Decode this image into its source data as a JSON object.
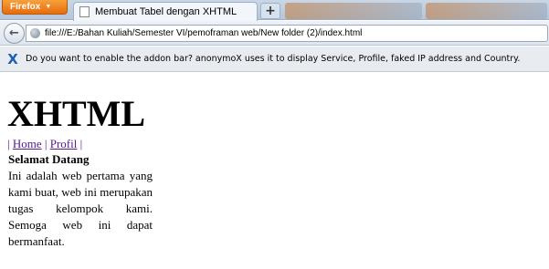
{
  "browser": {
    "menu_button": "Firefox",
    "tab_title": "Membuat Tabel dengan XHTML",
    "new_tab_symbol": "+",
    "url": "file:///E:/Bahan Kuliah/Semester VI/pemoframan web/New folder (2)/index.html"
  },
  "notification": {
    "message": "Do you want to enable the addon bar? anonymoX uses it to display Service, Profile, faked IP address and Country."
  },
  "page": {
    "title": "XHTML",
    "menu": {
      "separator": "|",
      "items": [
        {
          "label": "Home"
        },
        {
          "label": "Profil"
        }
      ]
    },
    "heading": "Selamat Datang",
    "body": "Ini adalah web pertama yang kami buat, web ini merupakan tugas kelompok kami. Semoga web ini dapat bermanfaat."
  },
  "colors": {
    "firefox_button": "#e56c0c",
    "visited_link": "#551a8b",
    "addon_icon": "#1f5fb3"
  },
  "icons": {
    "back": "back-arrow-icon",
    "site_identity": "globe-icon",
    "tab_favicon": "page-icon",
    "addon": "anonymox-x-icon"
  }
}
